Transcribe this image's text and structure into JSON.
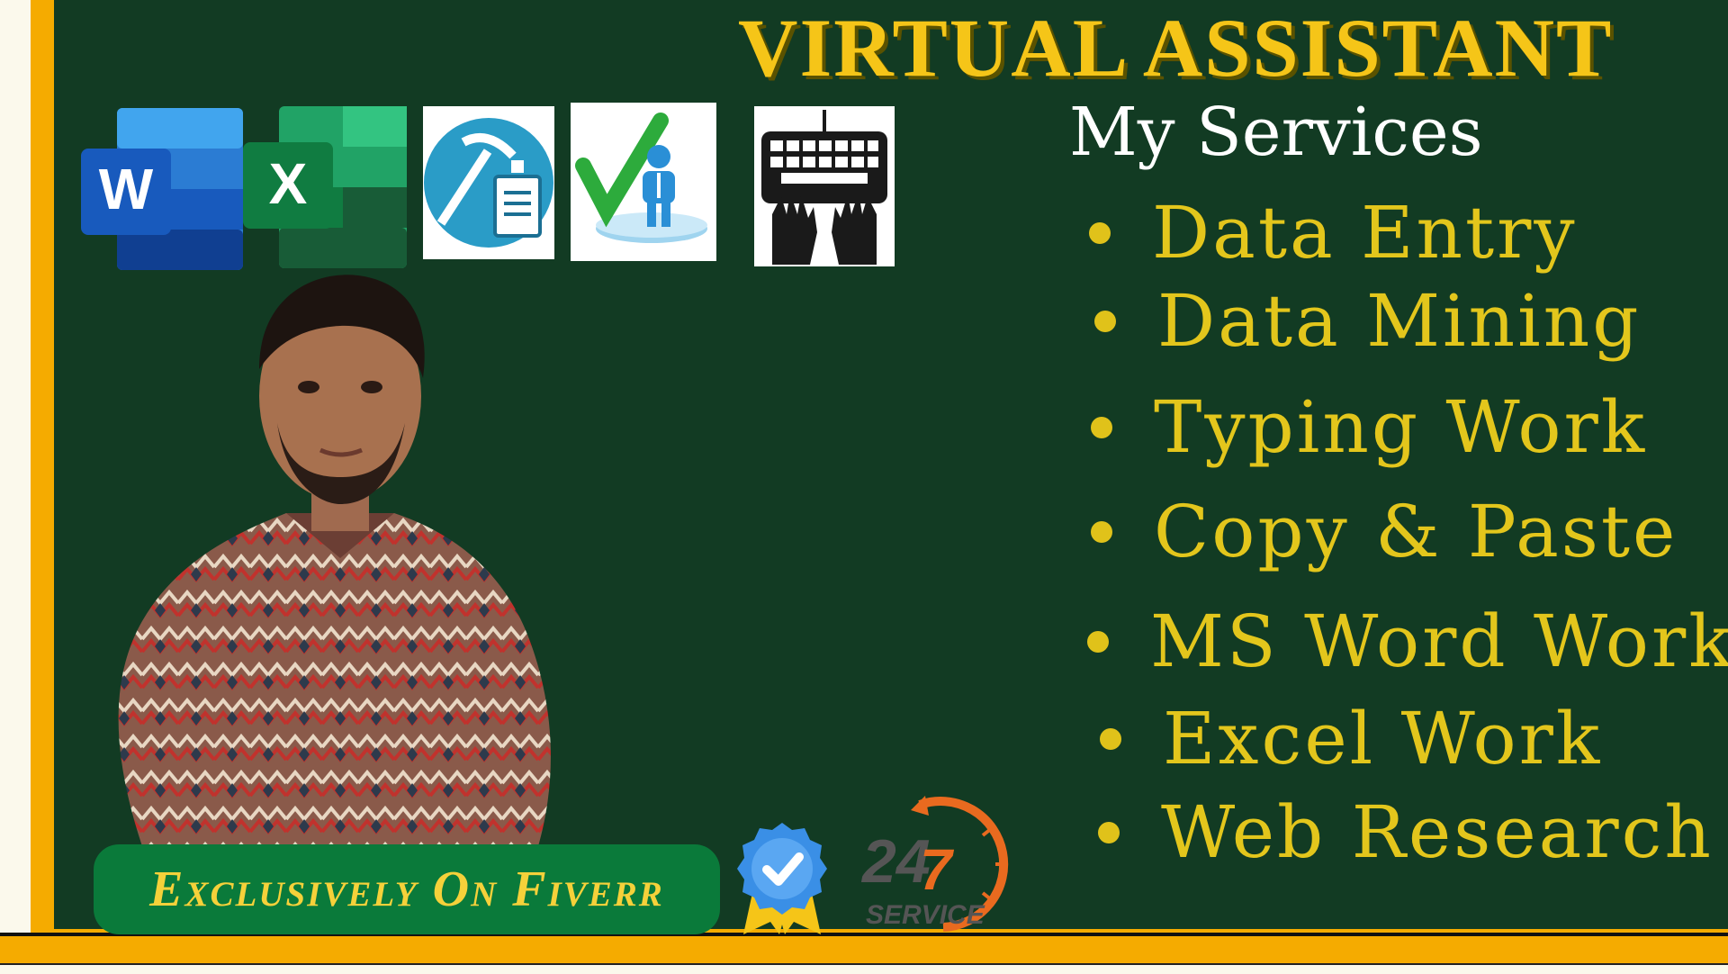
{
  "header": {
    "title": "VIRTUAL ASSISTANT",
    "subtitle": "My Services"
  },
  "services": [
    "Data Entry",
    "Data Mining",
    "Typing Work",
    "Copy & Paste",
    "MS Word Work",
    "Excel Work",
    "Web Research"
  ],
  "icons": {
    "word": {
      "name": "word-icon",
      "letter": "W"
    },
    "excel": {
      "name": "excel-icon",
      "letter": "X"
    },
    "mining": "data-mining-icon",
    "check": "checked-person-icon",
    "typing": "keyboard-hands-icon"
  },
  "footer": {
    "label": "Exclusively On Fiverr",
    "service_number_a": "24",
    "service_number_b": "7",
    "service_text": "SERVICE"
  },
  "colors": {
    "board": "#123b23",
    "frame": "#f5ab00",
    "title": "#f5c518",
    "service_text": "#e3c61c",
    "pill": "#0a7a3a"
  }
}
